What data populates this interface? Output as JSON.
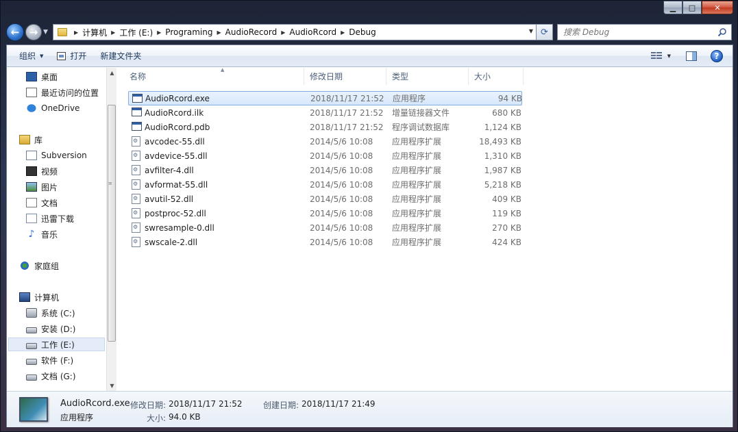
{
  "window": {
    "caption": {
      "minimize": "▁",
      "maximize": "□",
      "close": "✕"
    }
  },
  "address": {
    "breadcrumbs": [
      "计算机",
      "工作 (E:)",
      "Programing",
      "AudioRecord",
      "AudioRcord",
      "Debug"
    ],
    "search_placeholder": "搜索 Debug"
  },
  "toolbar": {
    "organize": "组织",
    "open": "打开",
    "new_folder": "新建文件夹"
  },
  "nav": {
    "favorites": [
      {
        "label": "桌面",
        "icon": "desktop-icon"
      },
      {
        "label": "最近访问的位置",
        "icon": "recent-places-icon"
      },
      {
        "label": "OneDrive",
        "icon": "onedrive-cloud-icon"
      }
    ],
    "libraries_header": "库",
    "libraries": [
      {
        "label": "Subversion",
        "icon": "subversion-icon"
      },
      {
        "label": "视频",
        "icon": "video-icon"
      },
      {
        "label": "图片",
        "icon": "picture-icon"
      },
      {
        "label": "文档",
        "icon": "document-icon"
      },
      {
        "label": "迅雷下载",
        "icon": "thunder-download-icon"
      },
      {
        "label": "音乐",
        "icon": "music-icon"
      }
    ],
    "homegroup": "家庭组",
    "computer_header": "计算机",
    "drives": [
      {
        "label": "系统 (C:)",
        "selected": false
      },
      {
        "label": "安装 (D:)",
        "selected": false
      },
      {
        "label": "工作 (E:)",
        "selected": true
      },
      {
        "label": "软件 (F:)",
        "selected": false
      },
      {
        "label": "文档 (G:)",
        "selected": false
      }
    ]
  },
  "columns": {
    "name": "名称",
    "date": "修改日期",
    "type": "类型",
    "size": "大小"
  },
  "files": [
    {
      "name": "AudioRcord.exe",
      "date": "2018/11/17 21:52",
      "type": "应用程序",
      "size": "94 KB",
      "kind": "exe",
      "selected": true
    },
    {
      "name": "AudioRcord.ilk",
      "date": "2018/11/17 21:52",
      "type": "增量链接器文件",
      "size": "680 KB",
      "kind": "ilk",
      "selected": false
    },
    {
      "name": "AudioRcord.pdb",
      "date": "2018/11/17 21:52",
      "type": "程序调试数据库",
      "size": "1,124 KB",
      "kind": "pdb",
      "selected": false
    },
    {
      "name": "avcodec-55.dll",
      "date": "2014/5/6 10:08",
      "type": "应用程序扩展",
      "size": "18,493 KB",
      "kind": "dll",
      "selected": false
    },
    {
      "name": "avdevice-55.dll",
      "date": "2014/5/6 10:08",
      "type": "应用程序扩展",
      "size": "1,310 KB",
      "kind": "dll",
      "selected": false
    },
    {
      "name": "avfilter-4.dll",
      "date": "2014/5/6 10:08",
      "type": "应用程序扩展",
      "size": "1,987 KB",
      "kind": "dll",
      "selected": false
    },
    {
      "name": "avformat-55.dll",
      "date": "2014/5/6 10:08",
      "type": "应用程序扩展",
      "size": "5,218 KB",
      "kind": "dll",
      "selected": false
    },
    {
      "name": "avutil-52.dll",
      "date": "2014/5/6 10:08",
      "type": "应用程序扩展",
      "size": "409 KB",
      "kind": "dll",
      "selected": false
    },
    {
      "name": "postproc-52.dll",
      "date": "2014/5/6 10:08",
      "type": "应用程序扩展",
      "size": "119 KB",
      "kind": "dll",
      "selected": false
    },
    {
      "name": "swresample-0.dll",
      "date": "2014/5/6 10:08",
      "type": "应用程序扩展",
      "size": "270 KB",
      "kind": "dll",
      "selected": false
    },
    {
      "name": "swscale-2.dll",
      "date": "2014/5/6 10:08",
      "type": "应用程序扩展",
      "size": "424 KB",
      "kind": "dll",
      "selected": false
    }
  ],
  "details": {
    "file_name": "AudioRcord.exe",
    "file_type": "应用程序",
    "modified_label": "修改日期:",
    "modified_value": "2018/11/17 21:52",
    "created_label": "创建日期:",
    "created_value": "2018/11/17 21:49",
    "size_label": "大小:",
    "size_value": "94.0 KB"
  },
  "colors": {
    "selection_bg": "#d6e7fb",
    "selection_border": "#84acdd",
    "toolbar_text": "#1e395b"
  }
}
